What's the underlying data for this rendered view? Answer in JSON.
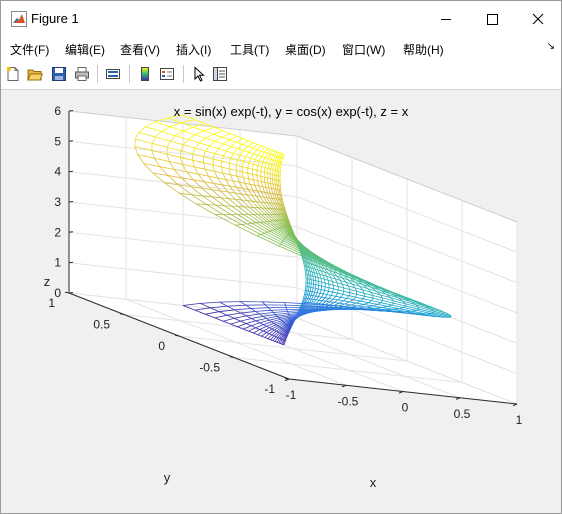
{
  "window": {
    "title": "Figure 1"
  },
  "menu": [
    {
      "label": "文件(F)"
    },
    {
      "label": "编辑(E)"
    },
    {
      "label": "查看(V)"
    },
    {
      "label": "插入(I)"
    },
    {
      "label": "工具(T)"
    },
    {
      "label": "桌面(D)"
    },
    {
      "label": "窗口(W)"
    },
    {
      "label": "帮助(H)"
    }
  ],
  "toolbar": {
    "icons": [
      "new-figure-icon",
      "open-file-icon",
      "save-icon",
      "print-icon",
      "link-plot-icon",
      "colorbar-icon",
      "legend-icon",
      "pointer-icon",
      "property-inspector-icon"
    ]
  },
  "colors": {
    "colormap_low": "#3e26a8",
    "colormap_mid": "#35b779",
    "colormap_high": "#f9fb0e"
  },
  "chart_data": {
    "type": "mesh",
    "title": "x = sin(x) exp(-t), y = cos(x) exp(-t), z = x",
    "xlabel": "x",
    "ylabel": "y",
    "zlabel": "z",
    "xlim": [
      -1,
      1
    ],
    "ylim": [
      -1,
      1
    ],
    "zlim": [
      0,
      6
    ],
    "xticks": [
      "-1",
      "-0.5",
      "0",
      "0.5",
      "1"
    ],
    "yticks": [
      "-1",
      "-0.5",
      "0",
      "0.5",
      "1"
    ],
    "zticks": [
      "0",
      "1",
      "2",
      "3",
      "4",
      "5",
      "6"
    ],
    "grid": true,
    "colormap": "parula",
    "surface": {
      "u_param_range": [
        0,
        6.28
      ],
      "t_param_range": [
        0,
        2.5
      ]
    }
  }
}
